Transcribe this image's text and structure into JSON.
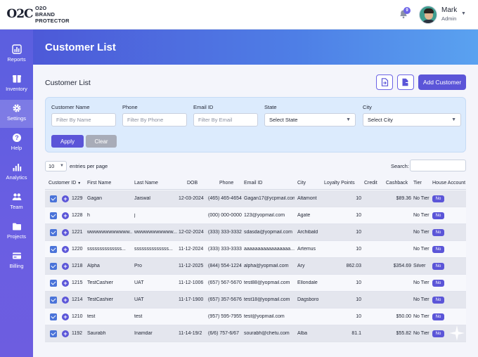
{
  "brand": {
    "logo_text": "O2C",
    "line1": "O2O",
    "line2": "BRAND",
    "line3": "PROTECTOR"
  },
  "topbar": {
    "notification_count": "9",
    "user_name": "Mark",
    "user_role": "Admin"
  },
  "sidebar": {
    "items": [
      {
        "label": "Reports",
        "icon": "bar-chart-icon"
      },
      {
        "label": "Inventory",
        "icon": "box-icon"
      },
      {
        "label": "Settings",
        "icon": "gear-icon",
        "active": true
      },
      {
        "label": "Help",
        "icon": "help-icon"
      },
      {
        "label": "Analytics",
        "icon": "analytics-icon"
      },
      {
        "label": "Team",
        "icon": "team-icon"
      },
      {
        "label": "Projects",
        "icon": "folder-icon"
      },
      {
        "label": "Billing",
        "icon": "billing-icon"
      }
    ]
  },
  "page": {
    "title": "Customer List",
    "section_title": "Customer List",
    "add_button": "Add Customer"
  },
  "filters": {
    "customer_name": {
      "label": "Customer Name",
      "placeholder": "Filter By Name"
    },
    "phone": {
      "label": "Phone",
      "placeholder": "Filter By Phone"
    },
    "email": {
      "label": "Email ID",
      "placeholder": "Filter By Email"
    },
    "state": {
      "label": "State",
      "value": "Select State"
    },
    "city": {
      "label": "City",
      "value": "Select City"
    },
    "apply": "Apply",
    "clear": "Clear"
  },
  "table_controls": {
    "entries_value": "10",
    "entries_label": "entries per page",
    "search_label": "Search:"
  },
  "table": {
    "headers": [
      "Customer ID",
      "First Name",
      "Last Name",
      "DOB",
      "Phone",
      "Email ID",
      "City",
      "Loyalty Points",
      "Credit",
      "Cashback",
      "Tier",
      "House Account"
    ],
    "rows": [
      {
        "id": "1229",
        "first": "Gagan",
        "last": "Jaiswal",
        "dob": "12-03-2024",
        "phone": "(465) 465-4654",
        "email": "Gagan17@ycpmail.com",
        "city": "Altamont",
        "points": "10",
        "credit": "",
        "cashback": "$89.36",
        "tier": "No Tier",
        "house": "No"
      },
      {
        "id": "1228",
        "first": "h",
        "last": "j",
        "dob": "",
        "phone": "(000) 000-0000",
        "email": "123@yopmail.com",
        "city": "Agate",
        "points": "10",
        "credit": "",
        "cashback": "",
        "tier": "No Tier",
        "house": "No"
      },
      {
        "id": "1221",
        "first": "wwwwwwwwwwww...",
        "last": "wwwwwwwwwww...",
        "dob": "12-02-2024",
        "phone": "(333) 333-3332",
        "email": "sdasda@yopmail.com",
        "city": "Archibald",
        "points": "10",
        "credit": "",
        "cashback": "",
        "tier": "No Tier",
        "house": "No"
      },
      {
        "id": "1220",
        "first": "ssssssssssssss...",
        "last": "ssssssssssssss...",
        "dob": "11-12-2024",
        "phone": "(333) 333-3333",
        "email": "aaaaaaaaaaaaaaaaa...",
        "city": "Artemus",
        "points": "10",
        "credit": "",
        "cashback": "",
        "tier": "No Tier",
        "house": "No"
      },
      {
        "id": "1218",
        "first": "Alpha",
        "last": "Pro",
        "dob": "11-12-2025",
        "phone": "(844) 554-1224",
        "email": "alpha@yopmail.com",
        "city": "Ary",
        "points": "862.03",
        "credit": "",
        "cashback": "$354.69",
        "tier": "Silver",
        "house": "No"
      },
      {
        "id": "1215",
        "first": "TestCashier",
        "last": "UAT",
        "dob": "11-12-1006",
        "phone": "(657) 567-5670",
        "email": "test88@yopmail.com",
        "city": "Ellondale",
        "points": "10",
        "credit": "",
        "cashback": "",
        "tier": "No Tier",
        "house": "No"
      },
      {
        "id": "1214",
        "first": "TestCashier",
        "last": "UAT",
        "dob": "11-17-1900",
        "phone": "(657) 357-5676",
        "email": "test18@yopmail.com",
        "city": "Dagsboro",
        "points": "10",
        "credit": "",
        "cashback": "",
        "tier": "No Tier",
        "house": "No"
      },
      {
        "id": "1210",
        "first": "test",
        "last": "test",
        "dob": "",
        "phone": "(957) 595-7955",
        "email": "test@yopmail.com",
        "city": "",
        "points": "10",
        "credit": "",
        "cashback": "$50.00",
        "tier": "No Tier",
        "house": "No"
      },
      {
        "id": "1192",
        "first": "Saurabh",
        "last": "Inamdar",
        "dob": "11-14-19/2",
        "phone": "(6/6) 757-6/67",
        "email": "sourabh@chetu.com",
        "city": "Alba",
        "points": "81.1",
        "credit": "",
        "cashback": "$55.82",
        "tier": "No Tier",
        "house": "No"
      }
    ]
  },
  "colors": {
    "accent": "#5b55d8",
    "sidebar": "#5b5fdf",
    "banner_start": "#4d59d8",
    "banner_end": "#5aa2f0",
    "filter_bg": "#dcebfd"
  }
}
